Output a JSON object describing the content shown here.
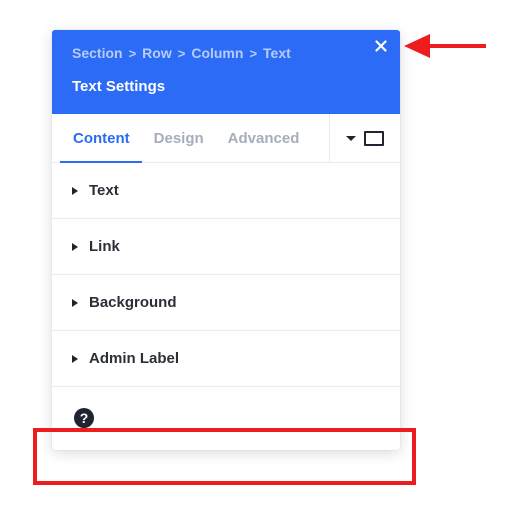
{
  "header": {
    "breadcrumb": [
      "Section",
      "Row",
      "Column",
      "Text"
    ],
    "breadcrumb_separator": ">",
    "title": "Text Settings",
    "close_icon": "close-icon",
    "background_color": "#2b6bf5"
  },
  "tabs": [
    {
      "label": "Content",
      "active": true
    },
    {
      "label": "Design",
      "active": false
    },
    {
      "label": "Advanced",
      "active": false
    }
  ],
  "toolbar": {
    "dropdown_icon": "caret-down-icon",
    "device_icon": "desktop-icon"
  },
  "sections": [
    {
      "label": "Text"
    },
    {
      "label": "Link"
    },
    {
      "label": "Background"
    },
    {
      "label": "Admin Label"
    }
  ],
  "help": {
    "icon_glyph": "?",
    "icon": "help-icon"
  },
  "annotations": {
    "arrow_color": "#ee1d1d",
    "box_color": "#ee1d1d"
  },
  "colors": {
    "accent": "#2b6bf5",
    "inactive_tab": "#a6aebb",
    "text": "#2b2f38"
  }
}
